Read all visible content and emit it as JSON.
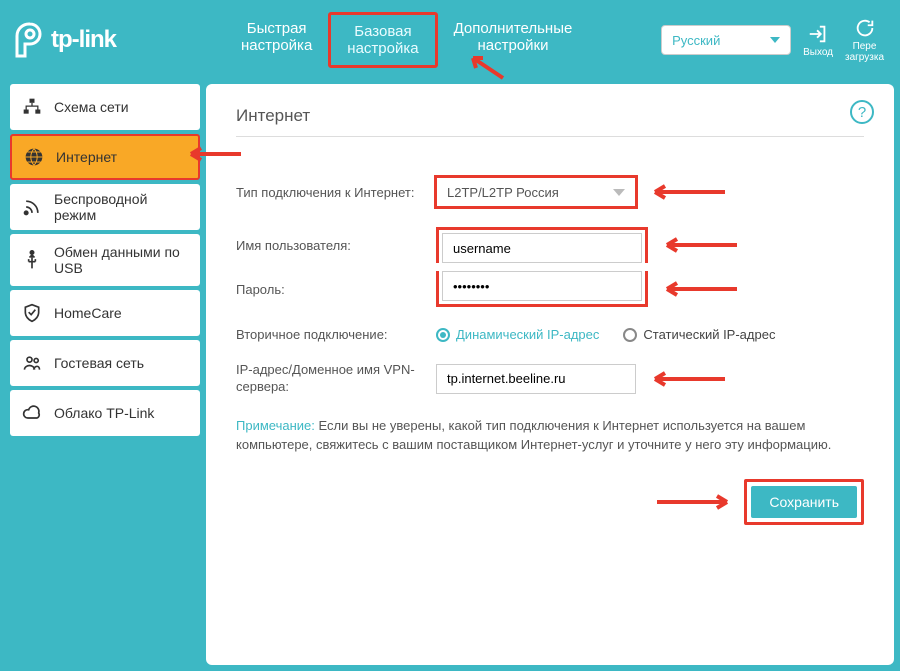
{
  "brand": "tp-link",
  "header": {
    "tabs": {
      "quick": "Быстрая\nнастройка",
      "basic": "Базовая\nнастройка",
      "advanced": "Дополнительные\nнастройки"
    },
    "language": "Русский",
    "logout": "Выход",
    "reload": "Пере\nзагрузка"
  },
  "sidebar": {
    "items": [
      {
        "label": "Схема сети"
      },
      {
        "label": "Интернет"
      },
      {
        "label": "Беспроводной режим"
      },
      {
        "label": "Обмен данными по USB"
      },
      {
        "label": "HomeCare"
      },
      {
        "label": "Гостевая сеть"
      },
      {
        "label": "Облако TP-Link"
      }
    ]
  },
  "page": {
    "title": "Интернет",
    "labels": {
      "conn_type": "Тип подключения к Интернет:",
      "username": "Имя пользователя:",
      "password": "Пароль:",
      "secondary": "Вторичное подключение:",
      "vpn": "IP-адрес/Доменное имя VPN-сервера:"
    },
    "values": {
      "conn_type": "L2TP/L2TP Россия",
      "username": "username",
      "password": "••••••••",
      "vpn": "tp.internet.beeline.ru"
    },
    "secondary_options": {
      "dynamic": "Динамический IP-адрес",
      "static": "Статический IP-адрес"
    },
    "note_label": "Примечание:",
    "note_text": "Если вы не уверены, какой тип подключения к Интернет используется на вашем компьютере, свяжитесь с вашим поставщиком Интернет-услуг и уточните у него эту информацию.",
    "save": "Сохранить"
  }
}
